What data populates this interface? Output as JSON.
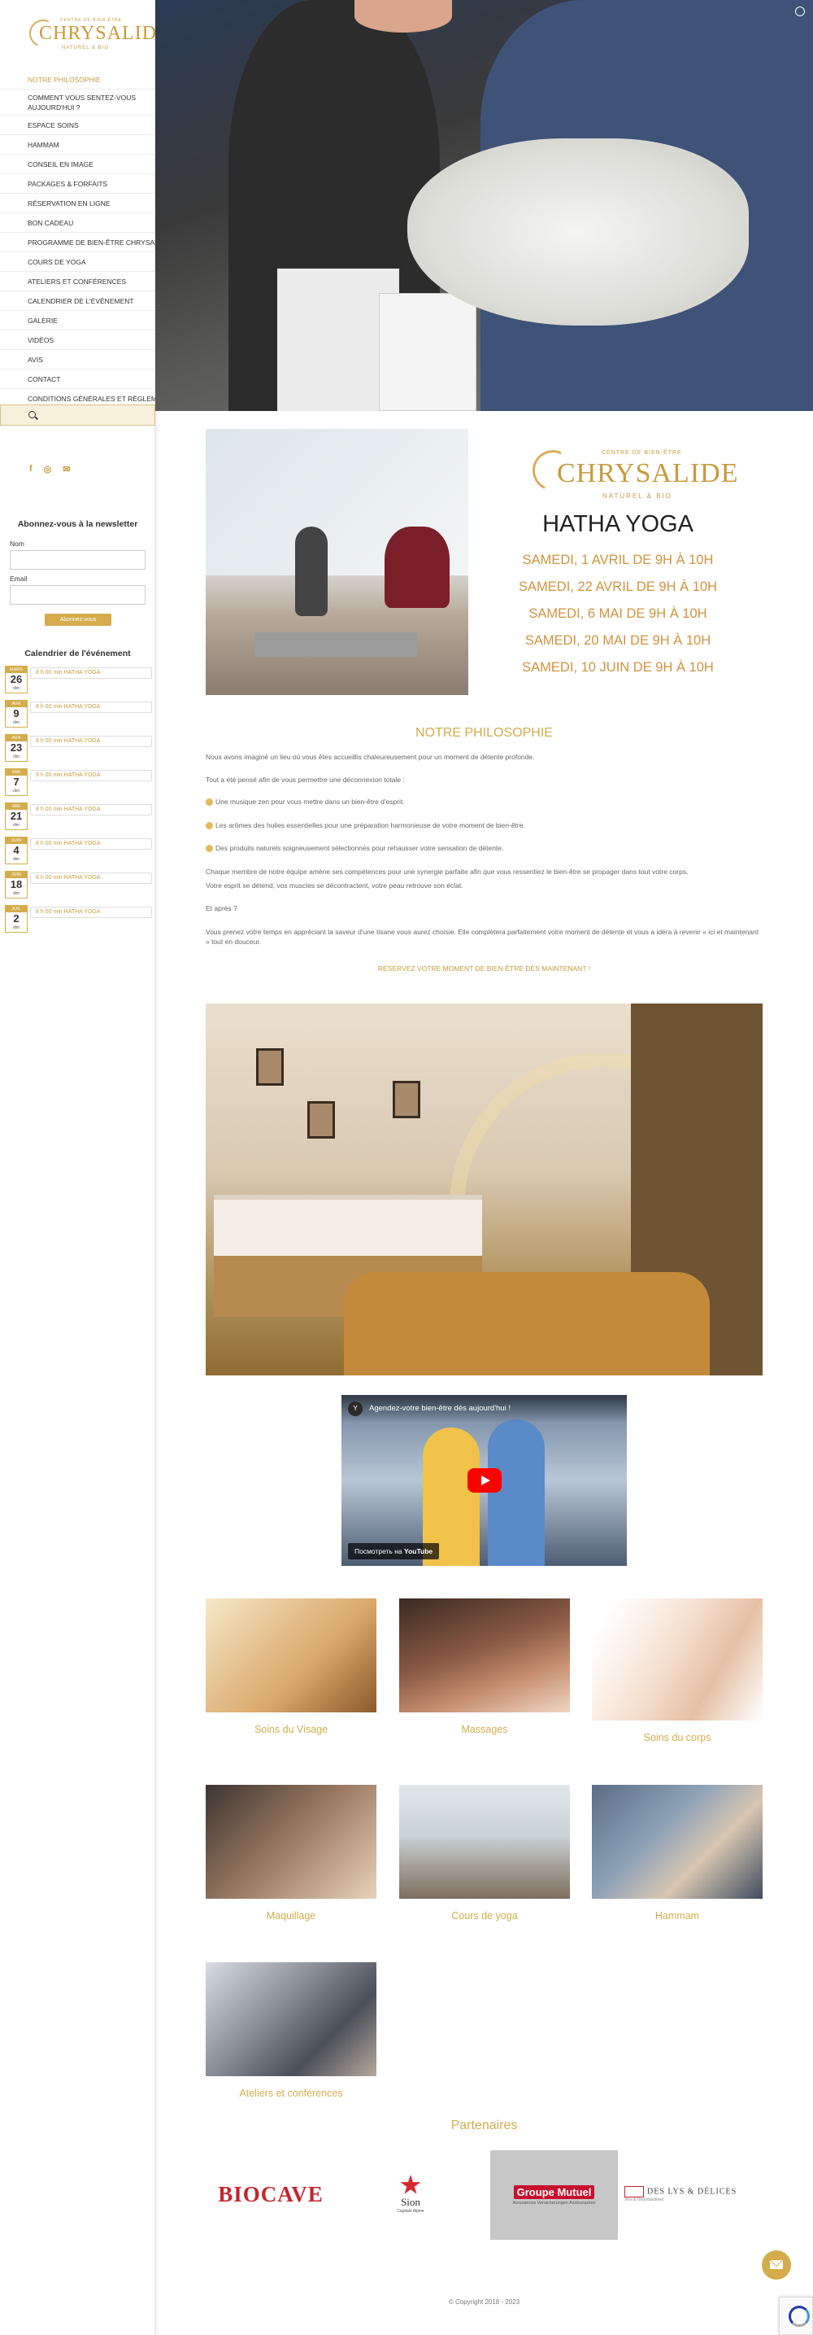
{
  "brand": {
    "name": "CHRYSALIDE",
    "top": "CENTRE DE BIEN-ÊTRE",
    "sub": "NATUREL & BIO"
  },
  "menu": [
    {
      "label": "NOTRE PHILOSOPHIE",
      "active": true
    },
    {
      "label": "COMMENT VOUS SENTEZ-VOUS AUJOURD'HUI ?"
    },
    {
      "label": "ESPACE SOINS"
    },
    {
      "label": "HAMMAM"
    },
    {
      "label": "CONSEIL EN IMAGE"
    },
    {
      "label": "PACKAGES & FORFAITS"
    },
    {
      "label": "RÉSERVATION EN LIGNE"
    },
    {
      "label": "BON CADEAU"
    },
    {
      "label": "PROGRAMME DE BIEN-ÊTRE CHRYSALIDE"
    },
    {
      "label": "COURS DE YOGA"
    },
    {
      "label": "ATELIERS ET CONFÉRENCES"
    },
    {
      "label": "CALENDRIER DE L'ÉVÉNEMENT"
    },
    {
      "label": "GALERIE"
    },
    {
      "label": "VIDÉOS"
    },
    {
      "label": "AVIS"
    },
    {
      "label": "CONTACT"
    },
    {
      "label": "CONDITIONS GÉNÉRALES ET RÈGLEMENT"
    }
  ],
  "socials": {
    "facebook": "f",
    "whatsapp": "◎",
    "email": "✉"
  },
  "newsletter": {
    "title": "Abonnez-vous à la newsletter",
    "name_label": "Nom",
    "email_label": "Email",
    "button": "Abonnez-vous"
  },
  "calendar": {
    "title": "Calendrier de l'événement",
    "events": [
      {
        "month": "MARS",
        "day": "26",
        "weekday": "dim",
        "time": "8 h 00 min",
        "name": "HATHA YOGA"
      },
      {
        "month": "AVR",
        "day": "9",
        "weekday": "dim",
        "time": "8 h 00 min",
        "name": "HATHA YOGA"
      },
      {
        "month": "AVR",
        "day": "23",
        "weekday": "dim",
        "time": "8 h 00 min",
        "name": "HATHA YOGA"
      },
      {
        "month": "MAI",
        "day": "7",
        "weekday": "dim",
        "time": "8 h 00 min",
        "name": "HATHA YOGA"
      },
      {
        "month": "MAI",
        "day": "21",
        "weekday": "dim",
        "time": "8 h 00 min",
        "name": "HATHA YOGA"
      },
      {
        "month": "JUIN",
        "day": "4",
        "weekday": "dim",
        "time": "8 h 00 min",
        "name": "HATHA YOGA"
      },
      {
        "month": "JUIN",
        "day": "18",
        "weekday": "dim",
        "time": "8 h 00 min",
        "name": "HATHA YOGA"
      },
      {
        "month": "JUIL",
        "day": "2",
        "weekday": "dim",
        "time": "8 h 00 min",
        "name": "HATHA YOGA"
      }
    ]
  },
  "poster": {
    "title": "HATHA YOGA",
    "dates": [
      "SAMEDI, 1 AVRIL DE 9H À 10H",
      "SAMEDI, 22 AVRIL DE 9H À 10H",
      "SAMEDI, 6 MAI DE 9H À 10H",
      "SAMEDI, 20 MAI DE 9H À 10H",
      "SAMEDI, 10 JUIN DE 9H À 10H"
    ]
  },
  "philosophy": {
    "title": "NOTRE PHILOSOPHIE",
    "p1": "Nous avons imaginé un lieu où vous êtes accueillis chaleureusement pour un moment de détente profonde.",
    "p2": "Tout a été pensé afin de vous permettre une déconnexion totale :",
    "b1": "Une musique zen pour vous mettre dans un bien-être d'esprit.",
    "b2": "Les arômes des huiles essentielles pour une préparation harmonieuse de votre moment de bien-être.",
    "b3": "Des produits naturels soigneusement sélectionnés pour rehausser votre sensation de détente.",
    "p3": "Chaque membre de notre équipe amène ses compétences pour une synergie parfaite afin que vous ressentiez le bien-être se propager dans tout votre corps.",
    "p4": "Votre esprit se détend, vos muscles se décontractent, votre peau retrouve son éclat.",
    "p5": "Et après ?",
    "p6": "Vous prenez votre temps en appréciant la saveur d'une tisane vous aurez choisie. Elle complètera parfaitement votre moment de détente et vous a idéra à revenir « ici et maintenant » tout en douceur.",
    "cta": "RÉSERVEZ VOTRE MOMENT DE BIEN-ÊTRE DÈS MAINTENANT !"
  },
  "video": {
    "title": "Agendez-votre bien-être dès aujourd'hui !",
    "channel": "Y",
    "watch_label": "Посмотреть на",
    "youtube": "YouTube"
  },
  "services": [
    {
      "caption": "Soins du Visage"
    },
    {
      "caption": "Massages"
    },
    {
      "caption": "Soins du corps"
    },
    {
      "caption": "Maquillage"
    },
    {
      "caption": "Cours de yoga"
    },
    {
      "caption": "Hammam"
    },
    {
      "caption": "Ateliers et conférences"
    }
  ],
  "partners": {
    "title": "Partenaires",
    "biocave": "BIOCAVE",
    "sion": "Sion",
    "sion_sub": "Capitale Alpine",
    "groupe_mutuel": "Groupe Mutuel",
    "groupe_mutuel_sub": "Assurances Versicherungen Assicurazioni",
    "lys": "DES LYS & DÉLICES",
    "lys_sub": "Vins & Gourmandises"
  },
  "footer": {
    "copyright": "© Copyright 2018 - 2023"
  },
  "colors": {
    "accent": "#d4ac4c",
    "text": "#555555",
    "sidebar_bg": "#ffffff"
  }
}
